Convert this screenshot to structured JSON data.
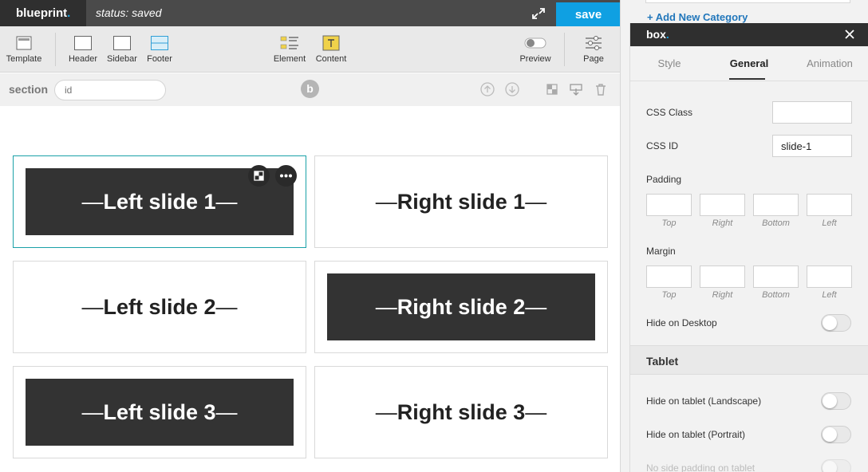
{
  "app": {
    "logo": "blueprint",
    "logo_dot": ".",
    "status": "status: saved",
    "save_label": "save"
  },
  "toolbar": {
    "items": [
      {
        "label": "Template",
        "icon": "template-icon"
      },
      {
        "label": "Header",
        "icon": "header-icon"
      },
      {
        "label": "Sidebar",
        "icon": "sidebar-icon"
      },
      {
        "label": "Footer",
        "icon": "footer-icon"
      },
      {
        "label": "Element",
        "icon": "element-icon"
      },
      {
        "label": "Content",
        "icon": "content-icon"
      },
      {
        "label": "Preview",
        "icon": "preview-toggle-icon"
      },
      {
        "label": "Page",
        "icon": "page-settings-icon"
      }
    ]
  },
  "section_bar": {
    "label": "section",
    "id_placeholder": "id",
    "badge": "b"
  },
  "slides": [
    {
      "text": "Left slide 1",
      "dark": true
    },
    {
      "text": "Right slide 1",
      "dark": false
    },
    {
      "text": "Left slide 2",
      "dark": false
    },
    {
      "text": "Right slide 2",
      "dark": true
    },
    {
      "text": "Left slide 3",
      "dark": true
    },
    {
      "text": "Right slide 3",
      "dark": false
    }
  ],
  "slide_dash": "—",
  "background_link": "+ Add New Category",
  "panel": {
    "title": "box",
    "title_dot": ".",
    "tabs": [
      "Style",
      "General",
      "Animation"
    ],
    "active_tab": "General",
    "css_class_label": "CSS Class",
    "css_class_value": "",
    "css_id_label": "CSS ID",
    "css_id_value": "slide-1",
    "padding_label": "Padding",
    "margin_label": "Margin",
    "sides": [
      "Top",
      "Right",
      "Bottom",
      "Left"
    ],
    "hide_desktop_label": "Hide on Desktop",
    "tablet_heading": "Tablet",
    "hide_tablet_landscape_label": "Hide on tablet (Landscape)",
    "hide_tablet_portrait_label": "Hide on tablet (Portrait)",
    "no_side_padding_label": "No side padding on tablet"
  },
  "colors": {
    "accent": "#0fa0e2",
    "active_outline": "#1ba1a8",
    "dark_block": "#333333",
    "topbar": "#4a4a4a"
  }
}
